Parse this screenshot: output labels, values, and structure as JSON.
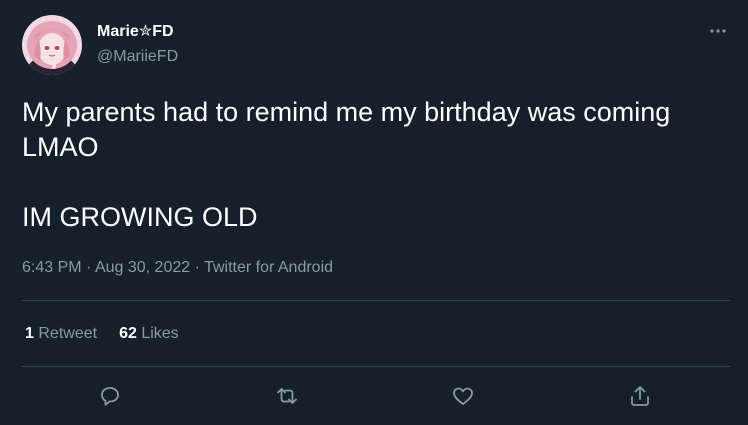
{
  "author": {
    "display_name": "Marie✮FD",
    "handle": "@MariieFD"
  },
  "tweet": {
    "text": "My parents had to remind me my birthday was coming\nLMAO\n\nIM GROWING OLD",
    "time": "6:43 PM",
    "date": "Aug 30, 2022",
    "source": "Twitter for Android",
    "separator": " · "
  },
  "stats": {
    "retweets_count": "1",
    "retweets_label": "Retweet",
    "likes_count": "62",
    "likes_label": "Likes"
  },
  "icons": {
    "more": "more-horizontal-icon",
    "reply": "reply-icon",
    "retweet": "retweet-icon",
    "like": "heart-icon",
    "share": "share-icon"
  },
  "colors": {
    "background": "#15202b",
    "text": "#ffffff",
    "secondary": "#8b98a5",
    "divider": "#38444d"
  }
}
